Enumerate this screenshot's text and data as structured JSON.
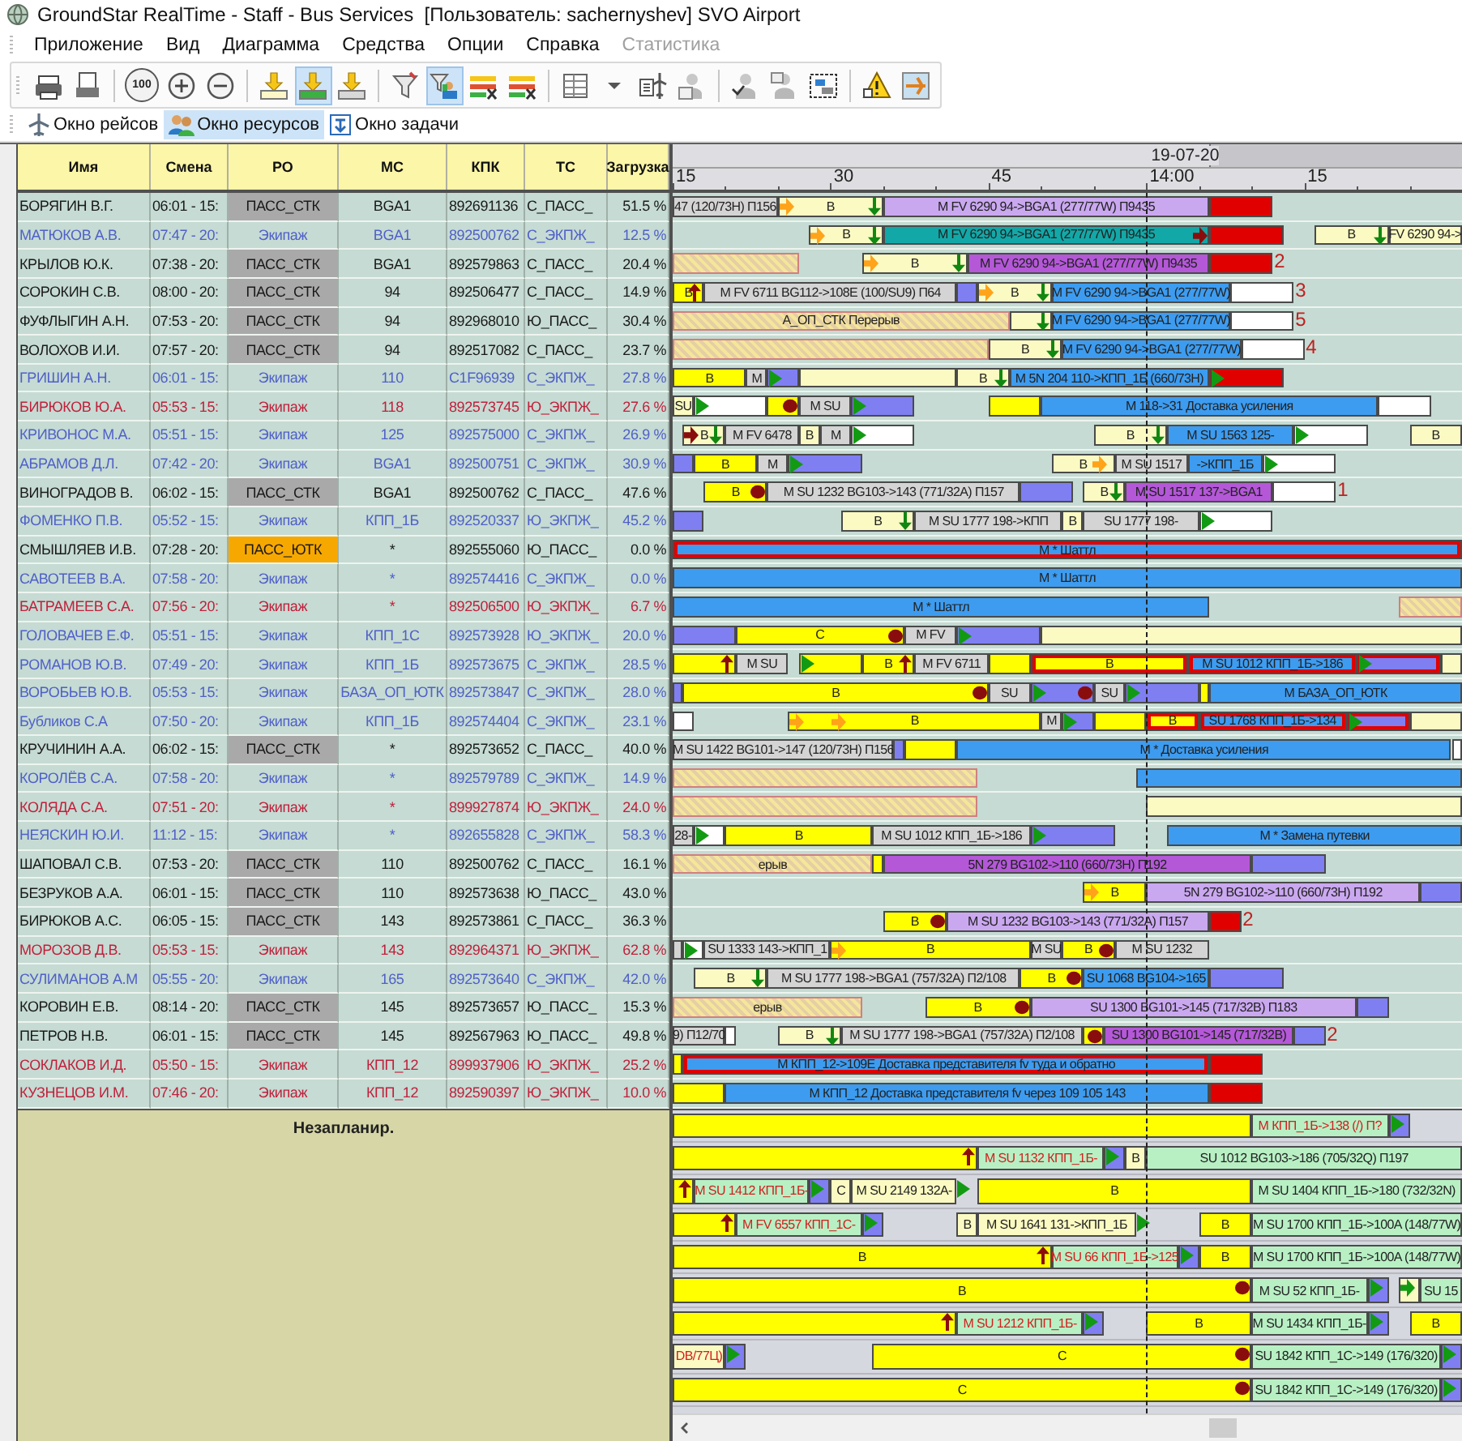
{
  "window": {
    "title": "GroundStar RealTime - Staff - Bus Services  [Пользователь: sachernyshev] SVO Airport"
  },
  "menu": [
    {
      "label": "Приложение",
      "disabled": false
    },
    {
      "label": "Вид",
      "disabled": false
    },
    {
      "label": "Диаграмма",
      "disabled": false
    },
    {
      "label": "Средства",
      "disabled": false
    },
    {
      "label": "Опции",
      "disabled": false
    },
    {
      "label": "Справка",
      "disabled": false
    },
    {
      "label": "Статистика",
      "disabled": true
    }
  ],
  "toolbar": [
    {
      "items": [
        {
          "selected": false
        },
        {
          "selected": false
        }
      ]
    },
    {
      "items": [
        {
          "text": "100",
          "selected": false
        },
        {
          "selected": false
        },
        {
          "selected": false
        }
      ]
    },
    {
      "items": [
        {
          "selected": false
        },
        {
          "selected": true
        },
        {
          "selected": false
        }
      ]
    },
    {
      "items": [
        {
          "selected": false
        },
        {
          "selected": true
        },
        {
          "selected": false
        },
        {
          "selected": false
        }
      ]
    },
    {
      "items": [
        {
          "selected": false
        },
        {
          "selected": false
        },
        {
          "selected": false
        },
        {
          "selected": false
        }
      ]
    },
    {
      "items": [
        {
          "selected": false
        },
        {
          "selected": false
        },
        {
          "selected": false
        }
      ]
    },
    {
      "items": [
        {
          "selected": false
        },
        {
          "selected": false
        }
      ]
    }
  ],
  "tabs": [
    {
      "label": "Окно рейсов",
      "selected": false
    },
    {
      "label": "Окно ресурсов",
      "selected": true
    },
    {
      "label": "Окно задачи",
      "selected": false
    }
  ],
  "table": {
    "columns": [
      "Имя",
      "Смена",
      "РО",
      "МС",
      "КПК",
      "ТС",
      "Загрузка"
    ]
  },
  "timeline": {
    "date": "19-07-20",
    "ticks": [
      "15",
      "30",
      "45",
      "14:00",
      "15"
    ]
  },
  "rows": [
    {
      "name": "БОРЯГИН В.Г.",
      "shift": "06:01 - 15:",
      "ro": {
        "text": "ПАСС_СТК",
        "color": "#a9a9a9"
      },
      "ms": "BGA1",
      "kpk": "892691136",
      "ts": "С_ПАСС_",
      "load": "51.5 %",
      "color": "#1a1a1a",
      "bars": [
        {
          "kind": "grey",
          "text": "47 (120/73H) П156"
        },
        {
          "kind": "pale",
          "text": "B"
        },
        {
          "kind": "lilac",
          "text": "M FV 6290 94->BGA1 (277/77W) П9435"
        },
        {
          "kind": "red"
        }
      ]
    },
    {
      "name": "МАТЮКОВ А.В.",
      "shift": "07:47 - 20:",
      "ro": {
        "text": "Экипаж"
      },
      "ms": "BGA1",
      "kpk": "892500762",
      "ts": "С_ЭКПЖ_",
      "load": "12.5 %",
      "color": "#5060c8",
      "bars": [
        {
          "kind": "pale",
          "text": "B"
        },
        {
          "kind": "teal",
          "text": "M FV 6290 94->BGA1 (277/77W) П9435"
        },
        {
          "kind": "red"
        },
        {
          "kind": "pale",
          "text": "B"
        },
        {
          "kind": "pale",
          "text": "FV 6290 94->"
        }
      ]
    },
    {
      "name": "КРЫЛОВ Ю.К.",
      "shift": "07:38 - 20:",
      "ro": {
        "text": "ПАСС_СТК",
        "color": "#a9a9a9"
      },
      "ms": "BGA1",
      "kpk": "892579863",
      "ts": "С_ПАСС_",
      "load": "20.4 %",
      "color": "#1a1a1a",
      "bars": [
        {
          "kind": "hatched"
        },
        {
          "kind": "pale",
          "text": "B"
        },
        {
          "kind": "purple",
          "text": "M FV 6290 94->BGA1 (277/77W) П9435"
        },
        {
          "kind": "red"
        }
      ],
      "notes": [
        "2"
      ]
    },
    {
      "name": "СОРОКИН С.В.",
      "shift": "08:00 - 20:",
      "ro": {
        "text": "ПАСС_СТК",
        "color": "#a9a9a9"
      },
      "ms": "94",
      "kpk": "892506477",
      "ts": "С_ПАСС_",
      "load": "14.9 %",
      "color": "#1a1a1a",
      "bars": [
        {
          "kind": "yellow",
          "text": "B"
        },
        {
          "kind": "grey",
          "text": "M FV 6711 BG112->108E (100/SU9) П64"
        },
        {
          "kind": "violet"
        },
        {
          "kind": "pale",
          "text": "B"
        },
        {
          "kind": "blue",
          "text": "M FV 6290 94->BGA1 (277/77W)"
        },
        {
          "kind": "white"
        }
      ],
      "notes": [
        "3"
      ]
    },
    {
      "name": "ФУФЛЫГИН А.Н.",
      "shift": "07:53 - 20:",
      "ro": {
        "text": "ПАСС_СТК",
        "color": "#a9a9a9"
      },
      "ms": "94",
      "kpk": "892968010",
      "ts": "Ю_ПАСС_",
      "load": "30.4 %",
      "color": "#1a1a1a",
      "bars": [
        {
          "kind": "hatched",
          "text": "А_ОП_СТК Перерыв"
        },
        {
          "kind": "pale"
        },
        {
          "kind": "blue",
          "text": "M FV 6290 94->BGA1 (277/77W)"
        },
        {
          "kind": "white"
        }
      ],
      "notes": [
        "5"
      ]
    },
    {
      "name": "ВОЛОХОВ И.И.",
      "shift": "07:57 - 20:",
      "ro": {
        "text": "ПАСС_СТК",
        "color": "#a9a9a9"
      },
      "ms": "94",
      "kpk": "892517082",
      "ts": "С_ПАСС_",
      "load": "23.7 %",
      "color": "#1a1a1a",
      "bars": [
        {
          "kind": "hatched"
        },
        {
          "kind": "pale",
          "text": "B"
        },
        {
          "kind": "blue",
          "text": "M FV 6290 94->BGA1 (277/77W)"
        },
        {
          "kind": "white"
        }
      ],
      "notes": [
        "4"
      ]
    },
    {
      "name": "ГРИШИН А.Н.",
      "shift": "06:01 - 15:",
      "ro": {
        "text": "Экипаж"
      },
      "ms": "110",
      "kpk": "C1F96939",
      "ts": "С_ЭКПЖ_",
      "load": "27.8 %",
      "color": "#5060c8",
      "bars": [
        {
          "kind": "yellow",
          "text": "B"
        },
        {
          "kind": "grey",
          "text": "M"
        },
        {
          "kind": "violet"
        },
        {
          "kind": "pale"
        },
        {
          "kind": "pale",
          "text": "B"
        },
        {
          "kind": "blue",
          "text": "M 5N 204 110->КПП_1Б (660/73H)"
        },
        {
          "kind": "red"
        }
      ]
    },
    {
      "name": "БИРЮКОВ Ю.А.",
      "shift": "05:53 - 15:",
      "ro": {
        "text": "Экипаж"
      },
      "ms": "118",
      "kpk": "892573745",
      "ts": "Ю_ЭКПЖ_",
      "load": "27.6 %",
      "color": "#c0203c",
      "bars": [
        {
          "kind": "pale",
          "text": "SU"
        },
        {
          "kind": "white"
        },
        {
          "kind": "yellow"
        },
        {
          "kind": "grey",
          "text": "M SU"
        },
        {
          "kind": "violet"
        },
        {
          "kind": "yellow"
        },
        {
          "kind": "blue",
          "text": "M 118->31 Доставка усиления"
        },
        {
          "kind": "white"
        }
      ]
    },
    {
      "name": "КРИВОНОС М.А.",
      "shift": "05:51 - 15:",
      "ro": {
        "text": "Экипаж"
      },
      "ms": "125",
      "kpk": "892575000",
      "ts": "С_ЭКПЖ_",
      "load": "26.9 %",
      "color": "#5060c8",
      "bars": [
        {
          "kind": "pale",
          "text": "B"
        },
        {
          "kind": "grey",
          "text": "M FV 6478"
        },
        {
          "kind": "pale",
          "text": "B"
        },
        {
          "kind": "grey",
          "text": "M"
        },
        {
          "kind": "white"
        },
        {
          "kind": "pale",
          "text": "B"
        },
        {
          "kind": "blue",
          "text": "M SU 1563 125-"
        },
        {
          "kind": "white"
        },
        {
          "kind": "pale",
          "text": "B"
        }
      ]
    },
    {
      "name": "АБРАМОВ Д.Л.",
      "shift": "07:42 - 20:",
      "ro": {
        "text": "Экипаж"
      },
      "ms": "BGA1",
      "kpk": "892500751",
      "ts": "С_ЭКПЖ_",
      "load": "30.9 %",
      "color": "#5060c8",
      "bars": [
        {
          "kind": "violet"
        },
        {
          "kind": "yellow",
          "text": "B"
        },
        {
          "kind": "grey",
          "text": "M"
        },
        {
          "kind": "violet"
        },
        {
          "kind": "pale",
          "text": "B"
        },
        {
          "kind": "grey",
          "text": "M SU 1517"
        },
        {
          "kind": "blue",
          "text": "->КПП_1Б"
        },
        {
          "kind": "white"
        }
      ]
    },
    {
      "name": "ВИНОГРАДОВ В.",
      "shift": "06:02 - 15:",
      "ro": {
        "text": "ПАСС_СТК",
        "color": "#a9a9a9"
      },
      "ms": "BGA1",
      "kpk": "892500762",
      "ts": "С_ПАСС_",
      "load": "47.6 %",
      "color": "#1a1a1a",
      "bars": [
        {
          "kind": "yellow",
          "text": "B"
        },
        {
          "kind": "grey",
          "text": "M SU 1232 BG103->143 (771/32A) П157"
        },
        {
          "kind": "violet"
        },
        {
          "kind": "pale",
          "text": "B"
        },
        {
          "kind": "purple",
          "text": "M SU 1517 137->BGA1"
        },
        {
          "kind": "white"
        }
      ],
      "notes": [
        "1"
      ]
    },
    {
      "name": "ФОМЕНКО П.В.",
      "shift": "05:52 - 15:",
      "ro": {
        "text": "Экипаж"
      },
      "ms": "КПП_1Б",
      "kpk": "892520337",
      "ts": "Ю_ЭКПЖ_",
      "load": "45.2 %",
      "color": "#5060c8",
      "bars": [
        {
          "kind": "violet"
        },
        {
          "kind": "pale",
          "text": "B"
        },
        {
          "kind": "grey",
          "text": "M SU 1777 198->КПП"
        },
        {
          "kind": "pale",
          "text": "B"
        },
        {
          "kind": "grey",
          "text": "SU 1777 198-"
        },
        {
          "kind": "white"
        }
      ]
    },
    {
      "name": "СМЫШЛЯЕВ И.В.",
      "shift": "07:28 - 20:",
      "ro": {
        "text": "ПАСС_ЮТК",
        "color": "#f7a800"
      },
      "ms": "*",
      "kpk": "892555060",
      "ts": "Ю_ПАСС_",
      "load": "0.0 %",
      "color": "#1a1a1a",
      "bars": [
        {
          "kind": "blue",
          "text": "M * Шаттл",
          "framed": true
        }
      ]
    },
    {
      "name": "САВОТЕЕВ В.А.",
      "shift": "07:58 - 20:",
      "ro": {
        "text": "Экипаж"
      },
      "ms": "*",
      "kpk": "892574416",
      "ts": "С_ЭКПЖ_",
      "load": "0.0 %",
      "color": "#5060c8",
      "bars": [
        {
          "kind": "blue",
          "text": "M * Шаттл",
          "framed": false
        }
      ]
    },
    {
      "name": "БАТРАМЕЕВ С.А.",
      "shift": "07:56 - 20:",
      "ro": {
        "text": "Экипаж"
      },
      "ms": "*",
      "kpk": "892506500",
      "ts": "Ю_ЭКПЖ_",
      "load": "6.7 %",
      "color": "#c0203c",
      "bars": [
        {
          "kind": "blue",
          "text": "M * Шаттл"
        },
        {
          "kind": "hatched"
        }
      ]
    },
    {
      "name": "ГОЛОВАЧЕВ Е.Ф.",
      "shift": "05:51 - 15:",
      "ro": {
        "text": "Экипаж"
      },
      "ms": "КПП_1С",
      "kpk": "892573928",
      "ts": "Ю_ЭКПЖ_",
      "load": "20.0 %",
      "color": "#5060c8",
      "bars": [
        {
          "kind": "violet"
        },
        {
          "kind": "yellow",
          "text": "C"
        },
        {
          "kind": "grey",
          "text": "M FV"
        },
        {
          "kind": "violet"
        },
        {
          "kind": "pale"
        }
      ]
    },
    {
      "name": "РОМАНОВ Ю.В.",
      "shift": "07:49 - 20:",
      "ro": {
        "text": "Экипаж"
      },
      "ms": "КПП_1Б",
      "kpk": "892573675",
      "ts": "С_ЭКПЖ_",
      "load": "28.5 %",
      "color": "#5060c8",
      "bars": [
        {
          "kind": "yellow"
        },
        {
          "kind": "grey",
          "text": "M SU"
        },
        {
          "kind": "yellow"
        },
        {
          "kind": "yellow",
          "text": "B"
        },
        {
          "kind": "grey",
          "text": "M FV 6711"
        },
        {
          "kind": "yellow"
        },
        {
          "kind": "yellow",
          "text": "B",
          "framed": true
        },
        {
          "kind": "blue",
          "text": "M SU 1012 КПП_1Б->186",
          "framed": true
        },
        {
          "kind": "violet",
          "framed": true
        },
        {
          "kind": "pale"
        }
      ]
    },
    {
      "name": "ВОРОБЬЕВ Ю.В.",
      "shift": "05:53 - 15:",
      "ro": {
        "text": "Экипаж"
      },
      "ms": "БАЗА_ОП_ЮТК",
      "kpk": "892573847",
      "ts": "С_ЭКПЖ_",
      "load": "28.0 %",
      "color": "#5060c8",
      "bars": [
        {
          "kind": "violet"
        },
        {
          "kind": "yellow",
          "text": "B"
        },
        {
          "kind": "grey",
          "text": "SU"
        },
        {
          "kind": "violet"
        },
        {
          "kind": "grey",
          "text": "SU"
        },
        {
          "kind": "violet"
        },
        {
          "kind": "yellow"
        },
        {
          "kind": "blue",
          "text": "M БАЗА_ОП_ЮТК"
        }
      ]
    },
    {
      "name": "Бубликов С.А",
      "shift": "07:50 - 20:",
      "ro": {
        "text": "Экипаж"
      },
      "ms": "КПП_1Б",
      "kpk": "892574404",
      "ts": "С_ЭКПЖ_",
      "load": "23.1 %",
      "color": "#5060c8",
      "bars": [
        {
          "kind": "white"
        },
        {
          "kind": "yellow",
          "text": "B"
        },
        {
          "kind": "grey",
          "text": "M"
        },
        {
          "kind": "violet"
        },
        {
          "kind": "yellow"
        },
        {
          "kind": "yellow",
          "text": "B",
          "framed": true
        },
        {
          "kind": "blue",
          "text": "SU 1768 КПП_1Б->134",
          "framed": true
        },
        {
          "kind": "violet",
          "framed": true
        },
        {
          "kind": "pale"
        }
      ]
    },
    {
      "name": "КРУЧИНИН А.А.",
      "shift": "06:02 - 15:",
      "ro": {
        "text": "ПАСС_СТК",
        "color": "#a9a9a9"
      },
      "ms": "*",
      "kpk": "892573652",
      "ts": "С_ПАСС_",
      "load": "40.0 %",
      "color": "#1a1a1a",
      "bars": [
        {
          "kind": "grey",
          "text": "M SU 1422 BG101->147 (120/73H) П156"
        },
        {
          "kind": "violet"
        },
        {
          "kind": "yellow"
        },
        {
          "kind": "blue",
          "text": "M * Доставка усиления"
        },
        {
          "kind": "white"
        }
      ]
    },
    {
      "name": "КОРОЛЁВ С.А.",
      "shift": "07:58 - 20:",
      "ro": {
        "text": "Экипаж"
      },
      "ms": "*",
      "kpk": "892579789",
      "ts": "С_ЭКПЖ_",
      "load": "14.9 %",
      "color": "#5060c8",
      "bars": [
        {
          "kind": "hatched"
        },
        {
          "kind": "blue"
        }
      ]
    },
    {
      "name": "КОЛЯДА С.А.",
      "shift": "07:51 - 20:",
      "ro": {
        "text": "Экипаж"
      },
      "ms": "*",
      "kpk": "899927874",
      "ts": "Ю_ЭКПЖ_",
      "load": "24.0 %",
      "color": "#c0203c",
      "bars": [
        {
          "kind": "hatched"
        },
        {
          "kind": "pale"
        }
      ]
    },
    {
      "name": "НЕЯСКИН Ю.И.",
      "shift": "11:12 - 15:",
      "ro": {
        "text": "Экипаж"
      },
      "ms": "*",
      "kpk": "892655828",
      "ts": "С_ЭКПЖ_",
      "load": "58.3 %",
      "color": "#5060c8",
      "bars": [
        {
          "kind": "grey",
          "text": "28-"
        },
        {
          "kind": "white"
        },
        {
          "kind": "yellow",
          "text": "B"
        },
        {
          "kind": "grey",
          "text": "M SU 1012 КПП_1Б->186"
        },
        {
          "kind": "violet"
        },
        {
          "kind": "blue",
          "text": "M * Замена путевки"
        }
      ]
    },
    {
      "name": "ШАПОВАЛ С.В.",
      "shift": "07:53 - 20:",
      "ro": {
        "text": "ПАСС_СТК",
        "color": "#a9a9a9"
      },
      "ms": "110",
      "kpk": "892500762",
      "ts": "С_ПАСС_",
      "load": "16.1 %",
      "color": "#1a1a1a",
      "bars": [
        {
          "kind": "hatched",
          "text": "ерыв"
        },
        {
          "kind": "yellow"
        },
        {
          "kind": "purple",
          "text": "5N 279 BG102->110 (660/73H) П192"
        },
        {
          "kind": "violet"
        }
      ]
    },
    {
      "name": "БЕЗРУКОВ А.А.",
      "shift": "06:01 - 15:",
      "ro": {
        "text": "ПАСС_СТК",
        "color": "#a9a9a9"
      },
      "ms": "110",
      "kpk": "892573638",
      "ts": "Ю_ПАСС_",
      "load": "43.0 %",
      "color": "#1a1a1a",
      "bars": [
        {
          "kind": "yellow",
          "text": "B"
        },
        {
          "kind": "lilac",
          "text": "5N 279 BG102->110 (660/73H) П192"
        },
        {
          "kind": "violet"
        }
      ]
    },
    {
      "name": "БИРЮКОВ А.С.",
      "shift": "06:05 - 15:",
      "ro": {
        "text": "ПАСС_СТК",
        "color": "#a9a9a9"
      },
      "ms": "143",
      "kpk": "892573861",
      "ts": "С_ПАСС_",
      "load": "36.3 %",
      "color": "#1a1a1a",
      "bars": [
        {
          "kind": "yellow",
          "text": "B"
        },
        {
          "kind": "lilac",
          "text": "M SU 1232 BG103->143 (771/32A) П157"
        },
        {
          "kind": "red"
        }
      ],
      "notes": [
        "2"
      ]
    },
    {
      "name": "МОРОЗОВ Д.В.",
      "shift": "05:53 - 15:",
      "ro": {
        "text": "Экипаж"
      },
      "ms": "143",
      "kpk": "892964371",
      "ts": "Ю_ЭКПЖ_",
      "load": "62.8 %",
      "color": "#c0203c",
      "bars": [
        {
          "kind": "grey"
        },
        {
          "kind": "white"
        },
        {
          "kind": "grey",
          "text": "SU 1333 143->КПП_1"
        },
        {
          "kind": "yellow",
          "text": "B"
        },
        {
          "kind": "grey",
          "text": "M SU"
        },
        {
          "kind": "yellow",
          "text": "B"
        },
        {
          "kind": "grey",
          "text": "M SU 1232"
        }
      ]
    },
    {
      "name": "СУЛИМАНОВ А.М",
      "shift": "05:55 - 20:",
      "ro": {
        "text": "Экипаж"
      },
      "ms": "165",
      "kpk": "892573640",
      "ts": "С_ЭКПЖ_",
      "load": "42.0 %",
      "color": "#5060c8",
      "bars": [
        {
          "kind": "pale",
          "text": "B"
        },
        {
          "kind": "grey",
          "text": "M SU 1777 198->BGA1 (757/32A) П2/108"
        },
        {
          "kind": "yellow",
          "text": "B"
        },
        {
          "kind": "blue",
          "text": "SU 1068 BG104->165"
        },
        {
          "kind": "violet"
        }
      ]
    },
    {
      "name": "КОРОВИН Е.В.",
      "shift": "08:14 - 20:",
      "ro": {
        "text": "ПАСС_СТК",
        "color": "#a9a9a9"
      },
      "ms": "145",
      "kpk": "892573657",
      "ts": "Ю_ПАСС_",
      "load": "15.3 %",
      "color": "#1a1a1a",
      "bars": [
        {
          "kind": "hatched",
          "text": "ерыв"
        },
        {
          "kind": "yellow",
          "text": "B"
        },
        {
          "kind": "lilac",
          "text": "SU 1300 BG101->145 (717/32B) П183"
        },
        {
          "kind": "violet"
        }
      ]
    },
    {
      "name": "ПЕТРОВ Н.В.",
      "shift": "06:01 - 15:",
      "ro": {
        "text": "ПАСС_СТК",
        "color": "#a9a9a9"
      },
      "ms": "145",
      "kpk": "892567963",
      "ts": "Ю_ПАСС_",
      "load": "49.8 %",
      "color": "#1a1a1a",
      "bars": [
        {
          "kind": "grey",
          "text": "9) П12/70"
        },
        {
          "kind": "white"
        },
        {
          "kind": "pale",
          "text": "B"
        },
        {
          "kind": "grey",
          "text": "M SU 1777 198->BGA1 (757/32A) П2/108"
        },
        {
          "kind": "yellow"
        },
        {
          "kind": "purple",
          "text": "SU 1300 BG101->145 (717/32B)"
        },
        {
          "kind": "violet"
        }
      ],
      "notes": [
        "2"
      ]
    },
    {
      "name": "СОКЛАКОВ И.Д.",
      "shift": "05:50 - 15:",
      "ro": {
        "text": "Экипаж"
      },
      "ms": "КПП_12",
      "kpk": "899937906",
      "ts": "Ю_ЭКПЖ_",
      "load": "25.2 %",
      "color": "#c0203c",
      "bars": [
        {
          "kind": "yellow"
        },
        {
          "kind": "blue",
          "text": "M КПП_12->109E Доставка представителя fv туда и обратно",
          "framed": true
        },
        {
          "kind": "red"
        }
      ]
    },
    {
      "name": "КУЗНЕЦОВ И.М.",
      "shift": "07:46 - 20:",
      "ro": {
        "text": "Экипаж"
      },
      "ms": "КПП_12",
      "kpk": "892590397",
      "ts": "Ю_ЭКПЖ_",
      "load": "10.0 %",
      "color": "#c0203c",
      "bars": [
        {
          "kind": "yellow"
        },
        {
          "kind": "blue",
          "text": "M КПП_12 Доставка представителя fv через 109 105 143",
          "framed": false
        },
        {
          "kind": "red"
        }
      ]
    }
  ],
  "unplanned": {
    "label": "Незапланир.",
    "rows": [
      {
        "bars": [
          {
            "kind": "yellow"
          },
          {
            "kind": "green",
            "text": "M КПП_1Б->138 (/) П?",
            "warn": true
          },
          {
            "kind": "violet"
          }
        ]
      },
      {
        "bars": [
          {
            "kind": "yellow"
          },
          {
            "kind": "green",
            "text": "M SU 1132 КПП_1Б-",
            "warn": true
          },
          {
            "kind": "violet"
          },
          {
            "kind": "pale",
            "text": "B"
          },
          {
            "kind": "green",
            "text": "SU 1012 BG103->186 (705/32Q) П197",
            "warn": false
          }
        ]
      },
      {
        "bars": [
          {
            "kind": "yellow"
          },
          {
            "kind": "green",
            "text": "M SU 1412 КПП_1Б-",
            "warn": true
          },
          {
            "kind": "violet"
          },
          {
            "kind": "pale",
            "text": "C"
          },
          {
            "kind": "pale",
            "text": "M SU 2149 132A-"
          },
          {
            "kind": "yellow",
            "text": "B"
          },
          {
            "kind": "green",
            "text": "M SU 1404 КПП_1Б->180 (732/32N)"
          }
        ]
      },
      {
        "bars": [
          {
            "kind": "yellow"
          },
          {
            "kind": "green",
            "text": "M FV 6557 КПП_1С-",
            "warn": true
          },
          {
            "kind": "violet"
          },
          {
            "kind": "pale",
            "text": "B"
          },
          {
            "kind": "pale",
            "text": "M SU 1641 131->КПП_1Б"
          },
          {
            "kind": "yellow",
            "text": "B"
          },
          {
            "kind": "green",
            "text": "M SU 1700 КПП_1Б->100A (148/77W)"
          }
        ]
      },
      {
        "bars": [
          {
            "kind": "yellow",
            "text": "B"
          },
          {
            "kind": "green",
            "text": "M SU 66 КПП_1Б->125",
            "warn": true
          },
          {
            "kind": "violet"
          },
          {
            "kind": "yellow",
            "text": "B"
          },
          {
            "kind": "green",
            "text": "M SU 1700 КПП_1Б->100A (148/77W)"
          }
        ]
      },
      {
        "bars": [
          {
            "kind": "yellow",
            "text": "B"
          },
          {
            "kind": "green",
            "text": "M SU 52 КПП_1Б-"
          },
          {
            "kind": "violet"
          },
          {
            "kind": "pale"
          },
          {
            "kind": "green",
            "text": "SU 15"
          }
        ]
      },
      {
        "bars": [
          {
            "kind": "yellow"
          },
          {
            "kind": "green",
            "text": "M SU 1212 КПП_1Б-",
            "warn": true
          },
          {
            "kind": "violet"
          },
          {
            "kind": "yellow",
            "text": "B"
          },
          {
            "kind": "green",
            "text": "M SU 1434 КПП_1Б-"
          },
          {
            "kind": "violet"
          },
          {
            "kind": "yellow",
            "text": "B"
          }
        ]
      },
      {
        "bars": [
          {
            "kind": "pale",
            "text": "DB/77Ц)",
            "warn": true
          },
          {
            "kind": "violet"
          },
          {
            "kind": "yellow",
            "text": "C"
          },
          {
            "kind": "green",
            "text": "SU 1842 КПП_1С->149 (176/320)"
          },
          {
            "kind": "violet"
          }
        ]
      },
      {
        "bars": [
          {
            "kind": "yellow",
            "text": "C"
          },
          {
            "kind": "green",
            "text": "SU 1842 КПП_1С->149 (176/320)"
          },
          {
            "kind": "violet"
          }
        ]
      }
    ]
  }
}
